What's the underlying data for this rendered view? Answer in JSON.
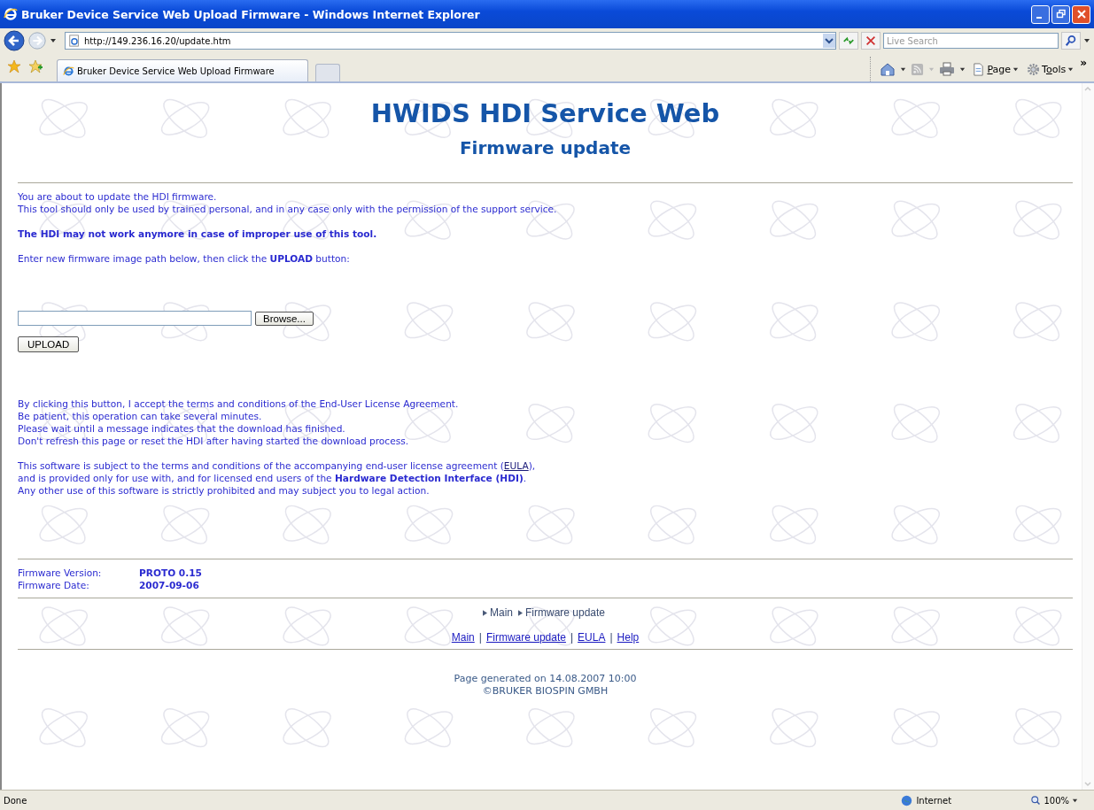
{
  "window": {
    "title": "Bruker Device Service Web Upload Firmware - Windows Internet Explorer"
  },
  "address_bar": {
    "url": "http://149.236.16.20/update.htm",
    "search_placeholder": "Live Search"
  },
  "tabs": [
    {
      "label": "Bruker Device Service Web Upload Firmware",
      "selected": true
    }
  ],
  "command_bar": {
    "page": "Page",
    "tools": "Tools",
    "overflow": "»"
  },
  "page": {
    "title": "HWIDS HDI Service Web",
    "subtitle": "Firmware update",
    "intro": [
      "You are about to update the HDI firmware.",
      "This tool should only be used by trained personal, and in any case only with the permission of the support service."
    ],
    "warning": "The HDI may not work anymore in case of improper use of this tool.",
    "instruction": "Enter new firmware image path below, then click the **UPLOAD** button:",
    "browse_button": "Browse...",
    "upload_button": "UPLOAD",
    "notes": [
      "By clicking this button, I accept the terms and conditions of the End-User License Agreement.",
      "Be patient, this operation can take several minutes.",
      "Please wait until a message indicates that the download has finished.",
      "Don't refresh this page or reset the HDI after having started the download process."
    ],
    "license": {
      "start": "This software is subject to the terms and conditions of the accompanying end-user license agreement (",
      "link": "EULA",
      "end": "),",
      "lines": [
        "and is provided only for use with, and for licensed end users of the **Hardware Detection Interface (HDI)**.",
        "Any other use of this software is strictly prohibited and may subject you to legal action."
      ]
    },
    "firmware_info": [
      {
        "label": "Firmware Version:",
        "value": "PROTO 0.15"
      },
      {
        "label": "Firmware Date:",
        "value": "2007-09-06"
      }
    ],
    "breadcrumb": [
      "Main",
      "Firmware update"
    ],
    "links": [
      "Main",
      "Firmware update",
      "EULA",
      "Help"
    ],
    "link_separator": "|",
    "footer": [
      "Page generated on 14.08.2007 10:00",
      "©BRUKER BIOSPIN GMBH"
    ]
  },
  "status_bar": {
    "status": "Done",
    "zone": "Internet",
    "zoom": "100%"
  }
}
